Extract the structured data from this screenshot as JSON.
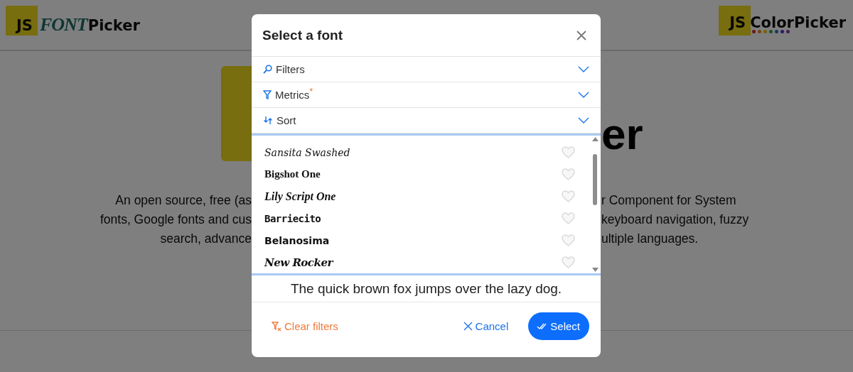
{
  "header": {
    "left_logo": {
      "prefix": "JS",
      "word": "FONT",
      "suffix": "Picker"
    },
    "right_logo": {
      "prefix": "JS",
      "word": "Color",
      "suffix": "Picker",
      "dots": [
        {
          "color": "#691717"
        },
        {
          "color": "#77450f"
        },
        {
          "color": "#74610d"
        },
        {
          "color": "#1e531e"
        },
        {
          "color": "#17376b"
        },
        {
          "color": "#251f5c"
        },
        {
          "color": "#451f5c"
        }
      ]
    }
  },
  "hero": {
    "heading": "er",
    "description_left": [
      "An open source, free (as",
      "fonts, Google fonts and cus",
      "search, advance"
    ],
    "description_right": [
      "r Component for System",
      "keyboard navigation, fuzzy",
      "ultiple languages."
    ]
  },
  "modal": {
    "title": "Select a font",
    "sections": [
      {
        "kind": "search",
        "label": "Filters",
        "expanded": false
      },
      {
        "kind": "filter",
        "label": "Metrics",
        "marker": "*",
        "expanded": false
      },
      {
        "kind": "sort",
        "label": "Sort",
        "expanded": false
      }
    ],
    "fonts": [
      {
        "name": "Sansita Swashed",
        "kind": "italic",
        "favorite": false
      },
      {
        "name": "Bigshot One",
        "kind": "bold-serif",
        "favorite": false
      },
      {
        "name": "Lily Script One",
        "kind": "script",
        "favorite": false
      },
      {
        "name": "Barriecito",
        "kind": "display",
        "favorite": false
      },
      {
        "name": "Belanosima",
        "kind": "sans",
        "favorite": false
      },
      {
        "name": "New Rocker",
        "kind": "blackletter",
        "favorite": false
      }
    ],
    "preview": "The quick brown fox jumps over the lazy dog.",
    "clear_filters": "Clear filters",
    "cancel": "Cancel",
    "select": "Select"
  }
}
